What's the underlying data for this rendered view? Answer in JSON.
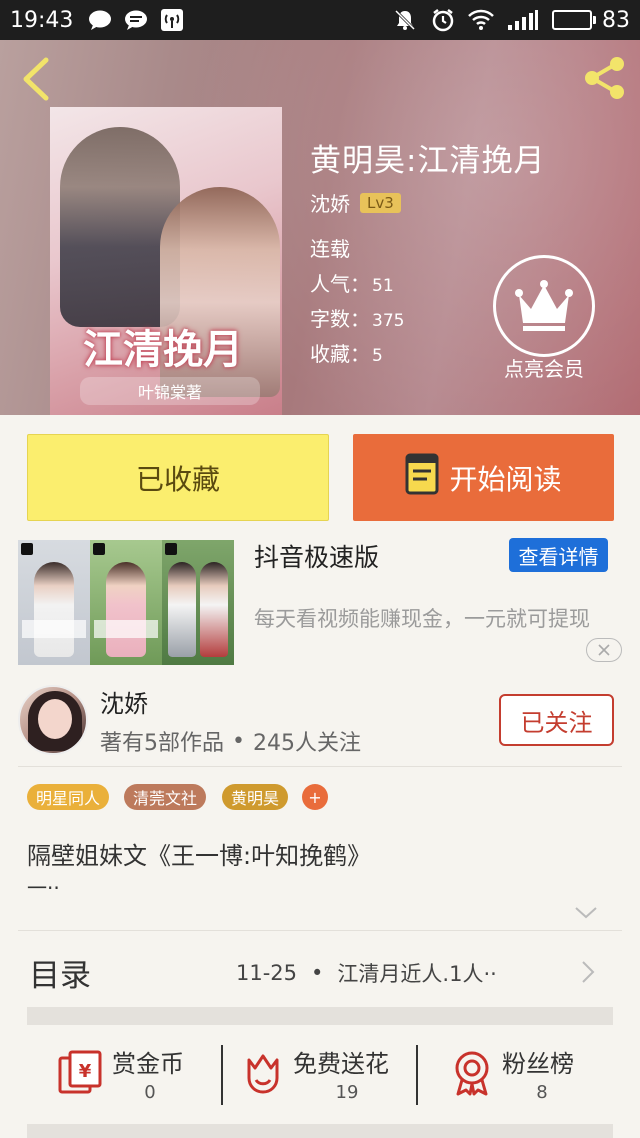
{
  "status_bar": {
    "time": "19:43",
    "battery": "83",
    "battery_level": 0.83
  },
  "header": {
    "back_icon": "chevron-left-icon",
    "share_icon": "share-icon",
    "cover_title_art": "江清挽月",
    "cover_author_art": "叶锦棠著",
    "book_title": "黄明昊:江清挽月",
    "author": "沈娇",
    "level": "Lv3",
    "status": "连载",
    "popularity_label": "人气：",
    "popularity": "51",
    "word_count_label": "字数：",
    "word_count": "375",
    "favorites_label": "收藏：",
    "favorites": "5",
    "vip_label": "点亮会员",
    "vip_icon": "crown-icon"
  },
  "actions": {
    "collected_label": "已收藏",
    "read_label": "开始阅读",
    "read_icon": "book-icon"
  },
  "ad": {
    "title": "抖音极速版",
    "detail_label": "查看详情",
    "description": "每天看视频能赚现金，一元就可提现",
    "close_icon": "close-icon"
  },
  "author_block": {
    "name": "沈娇",
    "works": "著有5部作品",
    "dot": "•",
    "followers": "245人关注",
    "follow_label": "已关注"
  },
  "tags": [
    {
      "label": "明星同人",
      "color": "#eab03a"
    },
    {
      "label": "清莞文社",
      "color": "#bd7a5c"
    },
    {
      "label": "黄明昊",
      "color": "#cf9a2e"
    }
  ],
  "tag_add": "+",
  "description": {
    "line1": "隔壁姐妹文《王一博:叶知挽鹤》",
    "line2": "一··"
  },
  "catalog": {
    "label": "目录",
    "date": "11-25",
    "dot": "•",
    "latest": "江清月近人.1人··"
  },
  "stats": [
    {
      "label": "赏金币",
      "value": "0",
      "icon": "coin-envelope-icon"
    },
    {
      "label": "免费送花",
      "value": "19",
      "icon": "flower-icon"
    },
    {
      "label": "粉丝榜",
      "value": "8",
      "icon": "medal-icon"
    }
  ],
  "colors": {
    "accent_orange": "#e96c3b",
    "collected_yellow": "#fbee6e",
    "follow_red": "#c43d2f",
    "ad_blue": "#1e6fd9",
    "level_gold": "#e8c25a"
  }
}
